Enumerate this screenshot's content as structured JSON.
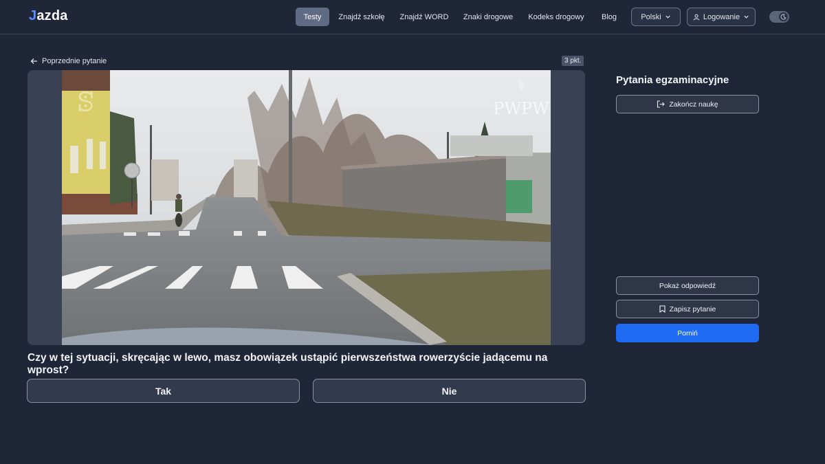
{
  "brand": {
    "prefix": "J",
    "rest": "azda"
  },
  "nav": [
    {
      "label": "Testy",
      "active": true
    },
    {
      "label": "Znajdź szkołę"
    },
    {
      "label": "Znajdź WORD"
    },
    {
      "label": "Znaki drogowe"
    },
    {
      "label": "Kodeks drogowy"
    },
    {
      "label": "Blog"
    }
  ],
  "language": {
    "label": "Polski"
  },
  "login": {
    "label": "Logowanie"
  },
  "back_link": {
    "label": "Poprzednie pytanie"
  },
  "points": {
    "label": "3 pkt."
  },
  "question": {
    "text": "Czy w tej sytuacji, skręcając w lewo, masz obowiązek ustąpić pierwszeństwa rowerzyście jadącemu na wprost?",
    "answers": [
      "Tak",
      "Nie"
    ],
    "watermark": "PWPW"
  },
  "sidebar": {
    "title": "Pytania egzaminacyjne",
    "end_label": "Zakończ naukę",
    "show_answer_label": "Pokaż odpowiedź",
    "save_label": "Zapisz pytanie",
    "skip_label": "Pomiń"
  },
  "colors": {
    "background": "#1f2638",
    "primary": "#1f6bf2",
    "accent_logo": "#5b8dff"
  }
}
